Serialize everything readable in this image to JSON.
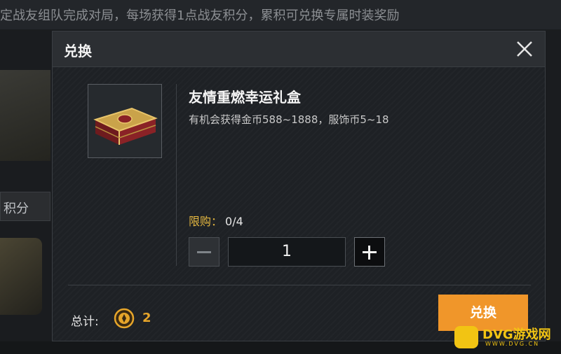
{
  "background": {
    "banner_text": "定战友组队完成对局，每场获得1点战友积分，累积可兑换专属时装奖励",
    "left_label": "积分"
  },
  "dialog": {
    "title": "兑换",
    "close_icon": "close-icon",
    "item": {
      "name": "友情重燃幸运礼盒",
      "description": "有机会获得金币588~1888，服饰币5~18",
      "icon": "gift-box-icon"
    },
    "limit": {
      "label": "限购：",
      "value": "0/4"
    },
    "quantity": {
      "value": "1",
      "minus_icon": "minus-icon",
      "plus_icon": "plus-icon"
    },
    "total": {
      "label": "总计:",
      "icon": "friendship-points-icon",
      "value": "2"
    },
    "exchange_button": "兑换"
  },
  "watermark": {
    "text": "DVG游戏网",
    "sub": "WWW.DVG.CN"
  },
  "colors": {
    "accent_orange": "#f0962a",
    "limit_yellow": "#e3b640",
    "total_gold": "#e6a52a"
  }
}
